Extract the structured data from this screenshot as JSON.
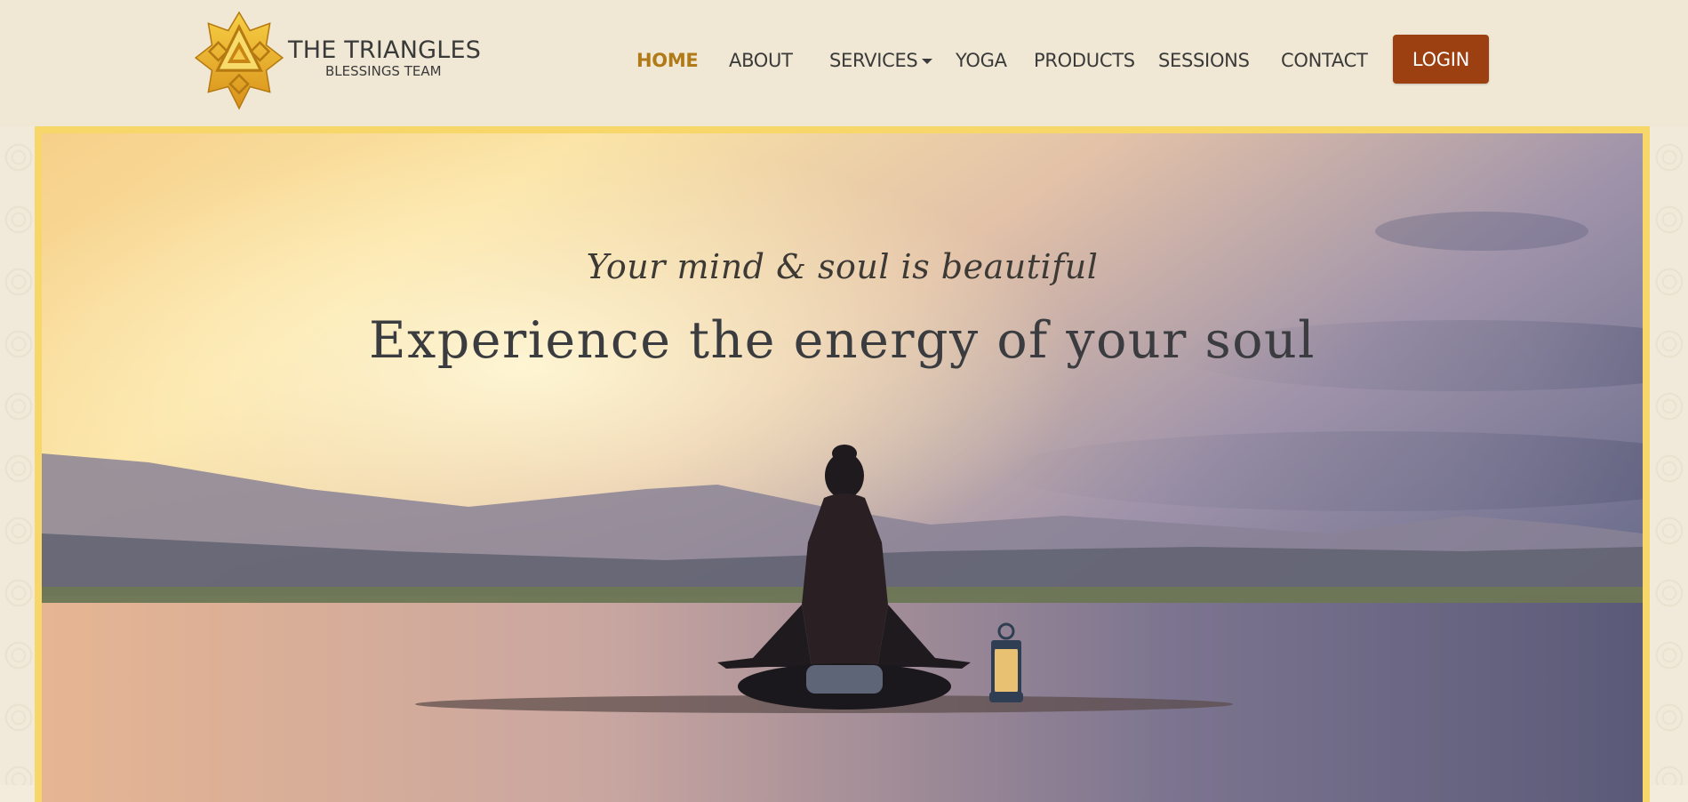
{
  "brand": {
    "title": "THE TRIANGLES",
    "subtitle": "BLESSINGS TEAM",
    "logo_icon": "triangle-lotus-emblem",
    "logo_color": "#e6a91e"
  },
  "nav": {
    "items": [
      {
        "label": "HOME",
        "active": true
      },
      {
        "label": "ABOUT"
      },
      {
        "label": "SERVICES",
        "dropdown": true
      },
      {
        "label": "YOGA"
      },
      {
        "label": "PRODUCTS"
      },
      {
        "label": "SESSIONS"
      },
      {
        "label": "CONTACT"
      }
    ],
    "login_label": "LOGIN",
    "active_color": "#b07a18",
    "login_color": "#9c4012"
  },
  "hero": {
    "tagline": "Your mind & soul is beautiful",
    "headline": "Experience the energy of your soul",
    "frame_color": "#f8d76a",
    "image": "woman-meditating-by-lake-with-lantern-at-sunset"
  }
}
